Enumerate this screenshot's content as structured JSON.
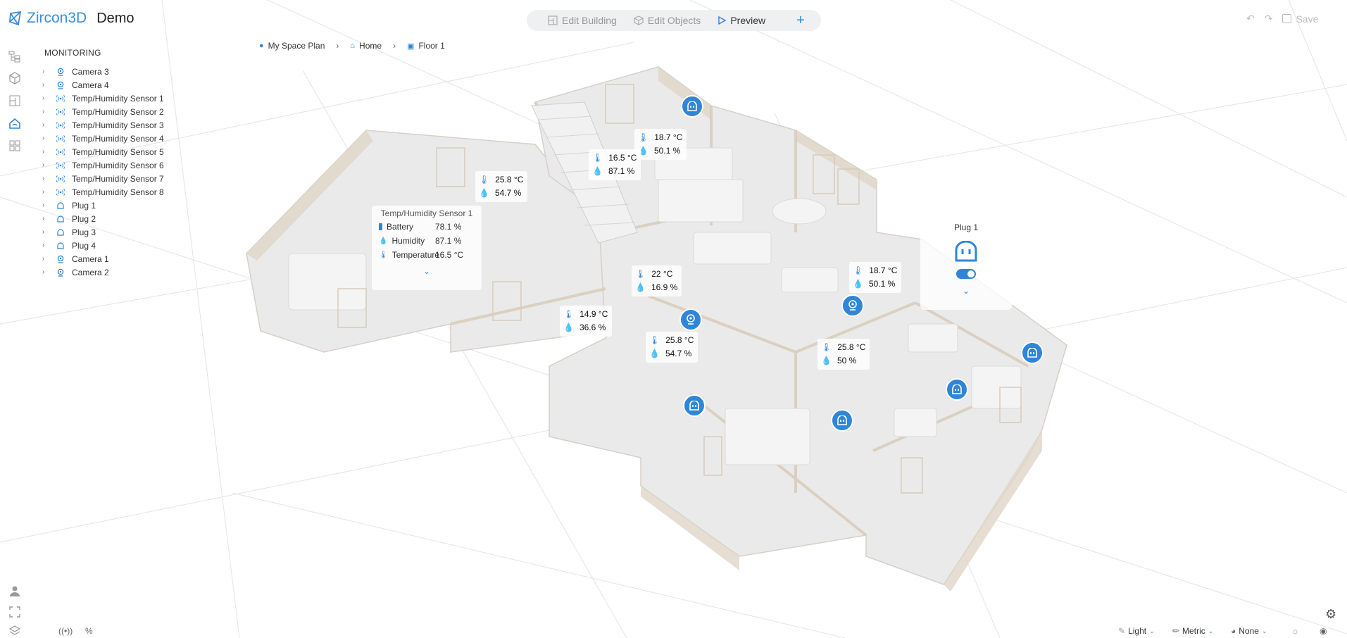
{
  "header": {
    "brand": "Zircon3D",
    "title": "Demo",
    "modes": [
      {
        "label": "Edit Building",
        "icon": "edit-building-icon"
      },
      {
        "label": "Edit Objects",
        "icon": "cube-icon"
      },
      {
        "label": "Preview",
        "icon": "play-icon"
      }
    ],
    "save_label": "Save"
  },
  "breadcrumb": [
    "My Space Plan",
    "Home",
    "Floor 1"
  ],
  "tree": {
    "title": "MONITORING",
    "items": [
      {
        "label": "Camera 3",
        "icon": "camera"
      },
      {
        "label": "Camera 4",
        "icon": "camera"
      },
      {
        "label": "Temp/Humidity Sensor 1",
        "icon": "sensor"
      },
      {
        "label": "Temp/Humidity Sensor 2",
        "icon": "sensor"
      },
      {
        "label": "Temp/Humidity Sensor 3",
        "icon": "sensor"
      },
      {
        "label": "Temp/Humidity Sensor 4",
        "icon": "sensor"
      },
      {
        "label": "Temp/Humidity Sensor 5",
        "icon": "sensor"
      },
      {
        "label": "Temp/Humidity Sensor 6",
        "icon": "sensor"
      },
      {
        "label": "Temp/Humidity Sensor 7",
        "icon": "sensor"
      },
      {
        "label": "Temp/Humidity Sensor 8",
        "icon": "sensor"
      },
      {
        "label": "Plug 1",
        "icon": "plug"
      },
      {
        "label": "Plug 2",
        "icon": "plug"
      },
      {
        "label": "Plug 3",
        "icon": "plug"
      },
      {
        "label": "Plug 4",
        "icon": "plug"
      },
      {
        "label": "Camera 1",
        "icon": "camera"
      },
      {
        "label": "Camera 2",
        "icon": "camera"
      }
    ]
  },
  "readings": [
    {
      "temp": "18.7 °C",
      "hum": "50.1 %"
    },
    {
      "temp": "16.5 °C",
      "hum": "87.1 %"
    },
    {
      "temp": "25.8 °C",
      "hum": "54.7 %"
    },
    {
      "temp": "22 °C",
      "hum": "16.9 %"
    },
    {
      "temp": "18.7 °C",
      "hum": "50.1 %"
    },
    {
      "temp": "14.9 °C",
      "hum": "36.6 %"
    },
    {
      "temp": "25.8 °C",
      "hum": "54.7 %"
    },
    {
      "temp": "25.8 °C",
      "hum": "50 %"
    }
  ],
  "sensor_popup": {
    "title": "Temp/Humidity Sensor 1",
    "rows": [
      {
        "key": "Battery",
        "value": "78.1 %"
      },
      {
        "key": "Humidity",
        "value": "87.1 %"
      },
      {
        "key": "Temperature",
        "value": "16.5 °C"
      }
    ]
  },
  "plug_popup": {
    "title": "Plug 1",
    "switch_on": true
  },
  "bottom": {
    "theme": "Light",
    "units": "Metric",
    "shadow": "None"
  },
  "colors": {
    "accent": "#2f86d9",
    "brand": "#3b8ed8"
  }
}
